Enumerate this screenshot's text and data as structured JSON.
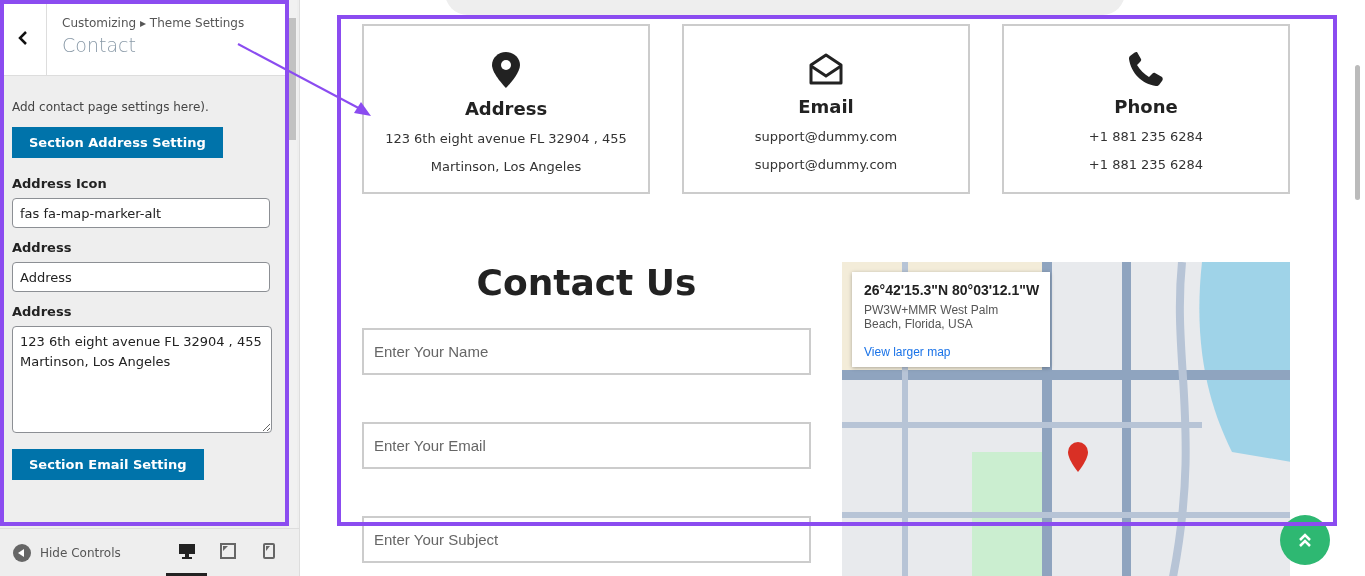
{
  "sidebar": {
    "breadcrumb": "Customizing ▸ Theme Settings",
    "title": "Contact",
    "description": "Add contact page settings here).",
    "controls": [
      {
        "kind": "button",
        "text": "Section Address Setting"
      },
      {
        "kind": "label",
        "text": "Address Icon"
      },
      {
        "kind": "input",
        "text": "fas fa-map-marker-alt"
      },
      {
        "kind": "label",
        "text": "Address"
      },
      {
        "kind": "input",
        "text": "Address"
      },
      {
        "kind": "label",
        "text": "Address"
      },
      {
        "kind": "textarea",
        "text": "123 6th eight avenue FL 32904 , 455\nMartinson, Los Angeles"
      },
      {
        "kind": "button",
        "text": "Section Email Setting"
      }
    ]
  },
  "footer": {
    "hide_controls": "Hide Controls",
    "devices": [
      {
        "selected": true
      },
      {
        "selected": false
      },
      {
        "selected": false
      }
    ]
  },
  "contact_cards": [
    {
      "title": "Address",
      "lines": [
        "123 6th eight avenue FL 32904 , 455",
        "Martinson, Los Angeles"
      ]
    },
    {
      "title": "Email",
      "lines": [
        "support@dummy.com",
        "support@dummy.com"
      ]
    },
    {
      "title": "Phone",
      "lines": [
        "+1 881 235 6284",
        "+1 881 235 6284"
      ]
    }
  ],
  "form": {
    "heading": "Contact Us",
    "fields": [
      {
        "placeholder": "Enter Your Name"
      },
      {
        "placeholder": "Enter Your Email"
      },
      {
        "placeholder": "Enter Your Subject"
      }
    ]
  },
  "map_info": {
    "coordinates": "26°42'15.3\"N 80°03'12.1\"W",
    "address": "PW3W+MMR West Palm Beach, Florida, USA",
    "link": "View larger map"
  }
}
